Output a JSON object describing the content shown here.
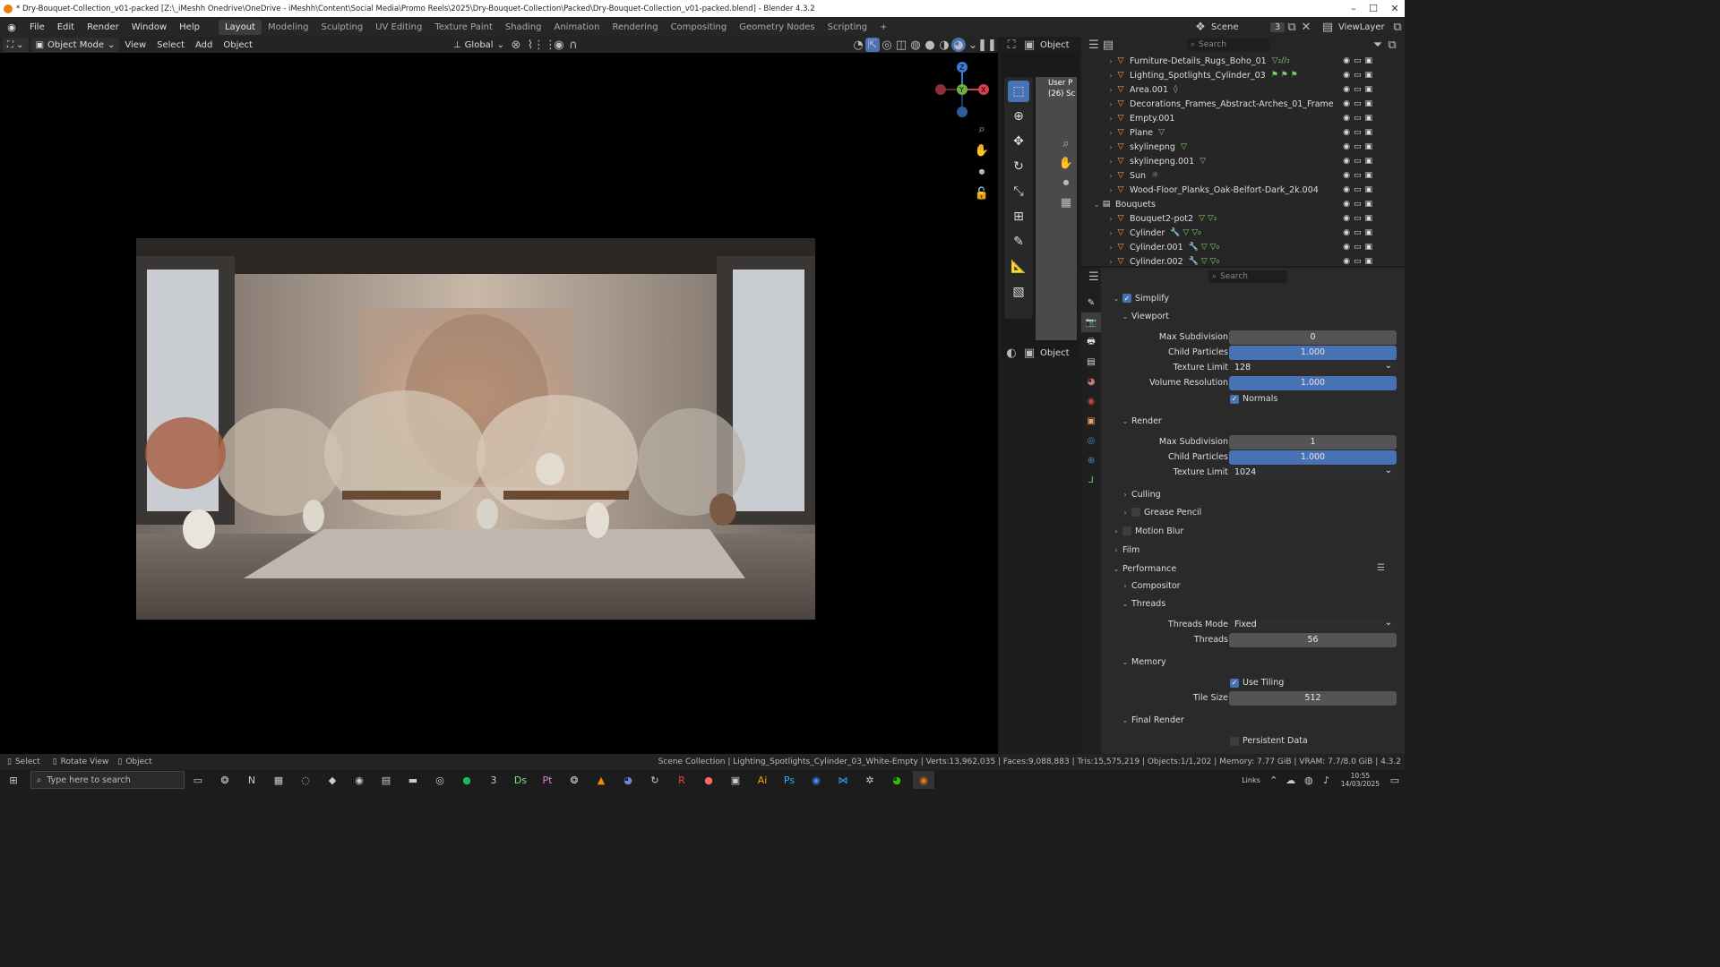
{
  "window": {
    "title": "* Dry-Bouquet-Collection_v01-packed [Z:\\_iMeshh Onedrive\\OneDrive - iMeshh\\Content\\Social Media\\Promo Reels\\2025\\Dry-Bouquet-Collection\\Packed\\Dry-Bouquet-Collection_v01-packed.blend] - Blender 4.3.2",
    "minimize": "–",
    "maximize": "☐",
    "close": "✕"
  },
  "menu": [
    "File",
    "Edit",
    "Render",
    "Window",
    "Help"
  ],
  "workspaces": [
    "Layout",
    "Modeling",
    "Sculpting",
    "UV Editing",
    "Texture Paint",
    "Shading",
    "Animation",
    "Rendering",
    "Compositing",
    "Geometry Nodes",
    "Scripting",
    "+"
  ],
  "scene": {
    "label": "Scene",
    "num": "3",
    "viewlayer": "ViewLayer"
  },
  "viewport_header": {
    "mode": "Object Mode",
    "items": [
      "View",
      "Select",
      "Add",
      "Object"
    ],
    "orientation": "Global"
  },
  "tool_header": {
    "object_label": "Object",
    "overlay_text": "User P",
    "overlay_sub": "(26) Sc"
  },
  "outliner": {
    "search_placeholder": "Search",
    "rows": [
      {
        "name": "Furniture-Details_Rugs_Boho_01",
        "extra": "▽₂//₂",
        "indent": 2
      },
      {
        "name": "Lighting_Spotlights_Cylinder_03",
        "extra": "⚑ ⚑ ⚑",
        "indent": 2
      },
      {
        "name": "Area.001",
        "extra": "◊",
        "indent": 2
      },
      {
        "name": "Decorations_Frames_Abstract-Arches_01_Frame",
        "extra": "",
        "indent": 2
      },
      {
        "name": "Empty.001",
        "extra": "",
        "indent": 2
      },
      {
        "name": "Plane",
        "extra": "▽",
        "indent": 2
      },
      {
        "name": "skylinepng",
        "extra": "▽",
        "indent": 2
      },
      {
        "name": "skylinepng.001",
        "extra": "▽",
        "indent": 2
      },
      {
        "name": "Sun",
        "extra": "☼",
        "indent": 2
      },
      {
        "name": "Wood-Floor_Planks_Oak-Belfort-Dark_2k.004",
        "extra": "",
        "indent": 2
      },
      {
        "name": "Bouquets",
        "extra": "",
        "indent": 1
      },
      {
        "name": "Bouquet2-pot2",
        "extra": "▽ ▽₂",
        "indent": 2
      },
      {
        "name": "Cylinder",
        "extra": "🔧 ▽ ▽₀",
        "indent": 2
      },
      {
        "name": "Cylinder.001",
        "extra": "🔧 ▽ ▽₀",
        "indent": 2
      },
      {
        "name": "Cylinder.002",
        "extra": "🔧 ▽ ▽₀",
        "indent": 2
      }
    ]
  },
  "properties": {
    "search_placeholder": "Search",
    "simplify": "Simplify",
    "viewport": "Viewport",
    "vp_max_sub_label": "Max Subdivision",
    "vp_max_sub": "0",
    "vp_child_label": "Child Particles",
    "vp_child": "1.000",
    "vp_tex_label": "Texture Limit",
    "vp_tex": "128",
    "vp_vol_label": "Volume Resolution",
    "vp_vol": "1.000",
    "normals": "Normals",
    "render": "Render",
    "r_max_sub_label": "Max Subdivision",
    "r_max_sub": "1",
    "r_child_label": "Child Particles",
    "r_child": "1.000",
    "r_tex_label": "Texture Limit",
    "r_tex": "1024",
    "culling": "Culling",
    "grease": "Grease Pencil",
    "motion": "Motion Blur",
    "film": "Film",
    "performance": "Performance",
    "compositor": "Compositor",
    "threads_section": "Threads",
    "threads_mode_label": "Threads Mode",
    "threads_mode": "Fixed",
    "threads_label": "Threads",
    "threads": "56",
    "memory": "Memory",
    "use_tiling": "Use Tiling",
    "tile_label": "Tile Size",
    "tile": "512",
    "final_render": "Final Render",
    "persistent": "Persistent Data"
  },
  "status": {
    "select": "Select",
    "rotate": "Rotate View",
    "object": "Object",
    "info": "Scene Collection | Lighting_Spotlights_Cylinder_03_White-Empty | Verts:13,962,035 | Faces:9,088,883 | Tris:15,575,219 | Objects:1/1,202 | Memory: 7.77 GiB | VRAM: 7.7/8.0 GiB | 4.3.2"
  },
  "taskbar": {
    "search_placeholder": "Type here to search",
    "links": "Links",
    "time": "10:55",
    "date": "14/03/2025"
  },
  "colors": {
    "accent": "#4772b3",
    "orange": "#e87d0d"
  }
}
